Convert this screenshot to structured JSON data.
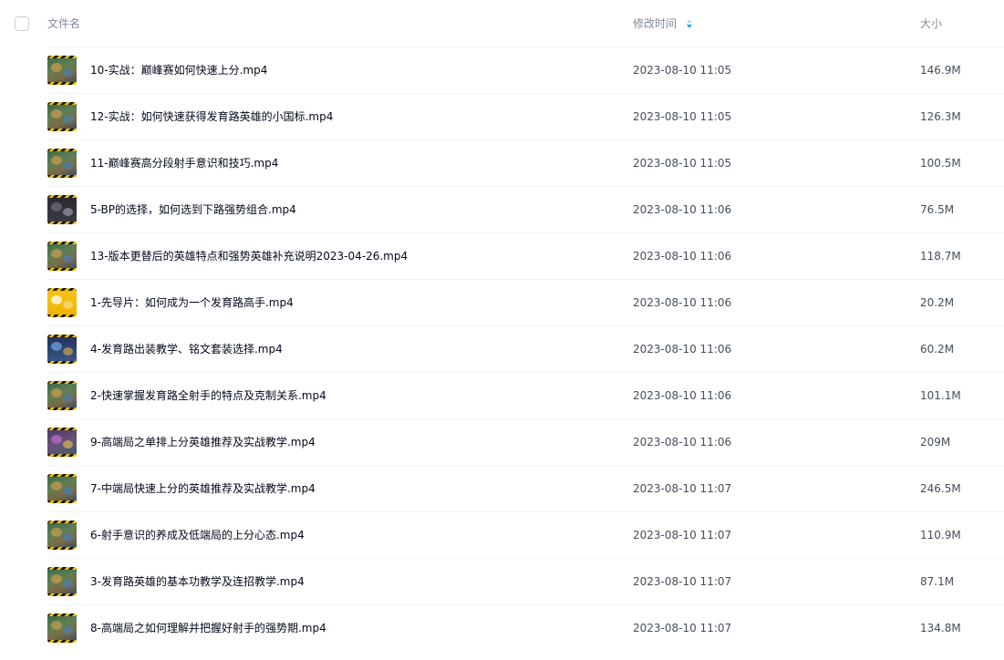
{
  "header": {
    "name_label": "文件名",
    "time_label": "修改时间",
    "size_label": "大小",
    "sort_icon": "sort-desc-icon"
  },
  "colors": {
    "sort_active": "#06a7ff",
    "sort_inactive": "#c5d9ee",
    "row_divider": "#f2f3f5",
    "header_text": "#818999"
  },
  "files": [
    {
      "name": "10-实战：巅峰赛如何快速上分.mp4",
      "modified": "2023-08-10 11:05",
      "size": "146.9M",
      "thumb": "game-scene"
    },
    {
      "name": "12-实战：如何快速获得发育路英雄的小国标.mp4",
      "modified": "2023-08-10 11:05",
      "size": "126.3M",
      "thumb": "game-scene"
    },
    {
      "name": "11-巅峰赛高分段射手意识和技巧.mp4",
      "modified": "2023-08-10 11:05",
      "size": "100.5M",
      "thumb": "game-scene"
    },
    {
      "name": "5-BP的选择，如何选到下路强势组合.mp4",
      "modified": "2023-08-10 11:06",
      "size": "76.5M",
      "thumb": "dark-menu"
    },
    {
      "name": "13-版本更替后的英雄特点和强势英雄补充说明2023-04-26.mp4",
      "modified": "2023-08-10 11:06",
      "size": "118.7M",
      "thumb": "game-scene"
    },
    {
      "name": "1-先导片：如何成为一个发育路高手.mp4",
      "modified": "2023-08-10 11:06",
      "size": "20.2M",
      "thumb": "yellow-slide"
    },
    {
      "name": "4-发育路出装教学、铭文套装选择.mp4",
      "modified": "2023-08-10 11:06",
      "size": "60.2M",
      "thumb": "blue-menu"
    },
    {
      "name": "2-快速掌握发育路全射手的特点及克制关系.mp4",
      "modified": "2023-08-10 11:06",
      "size": "101.1M",
      "thumb": "game-scene"
    },
    {
      "name": "9-高端局之单排上分英雄推荐及实战教学.mp4",
      "modified": "2023-08-10 11:06",
      "size": "209M",
      "thumb": "purple-scene"
    },
    {
      "name": "7-中端局快速上分的英雄推荐及实战教学.mp4",
      "modified": "2023-08-10 11:07",
      "size": "246.5M",
      "thumb": "game-scene"
    },
    {
      "name": "6-射手意识的养成及低端局的上分心态.mp4",
      "modified": "2023-08-10 11:07",
      "size": "110.9M",
      "thumb": "game-scene"
    },
    {
      "name": "3-发育路英雄的基本功教学及连招教学.mp4",
      "modified": "2023-08-10 11:07",
      "size": "87.1M",
      "thumb": "game-scene"
    },
    {
      "name": "8-高端局之如何理解并把握好射手的强势期.mp4",
      "modified": "2023-08-10 11:07",
      "size": "134.8M",
      "thumb": "game-scene"
    }
  ]
}
